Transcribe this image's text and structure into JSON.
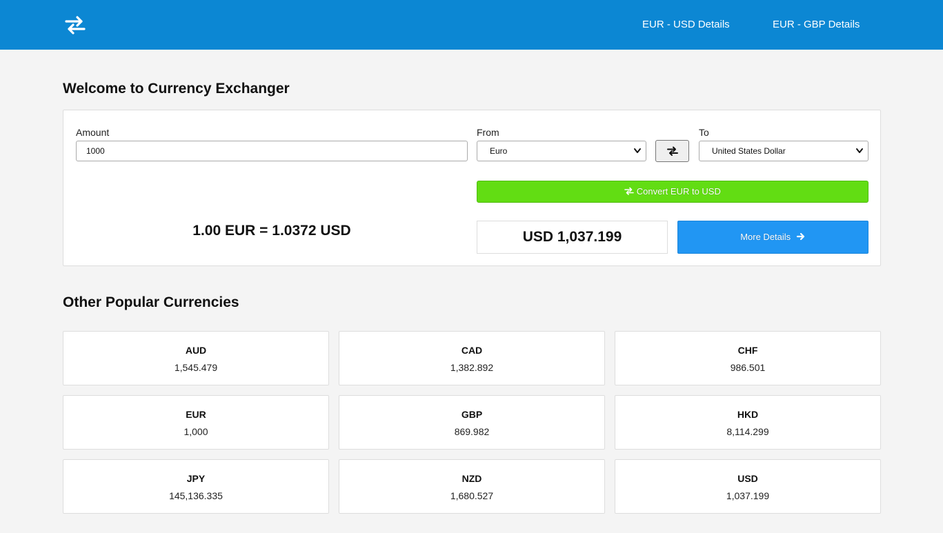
{
  "header": {
    "logo_icon": "exchange-arrows-icon",
    "nav": [
      {
        "label": "EUR - USD Details"
      },
      {
        "label": "EUR - GBP Details"
      }
    ],
    "color": "#0c87d3"
  },
  "main": {
    "title": "Welcome to Currency Exchanger"
  },
  "converter": {
    "amount_label": "Amount",
    "amount_value": "1000",
    "from_label": "From",
    "from_value": "Euro",
    "to_label": "To",
    "to_value": "United States Dollar",
    "swap_icon": "swap-arrows-icon",
    "convert_label": "Convert EUR to USD",
    "convert_color": "#62dd13",
    "rate_text": "1.00 EUR = 1.0372 USD",
    "result": "USD 1,037.199",
    "details_label": "More Details",
    "details_icon": "arrow-right-icon",
    "details_color": "#2196f3"
  },
  "popular": {
    "title": "Other Popular Currencies",
    "items": [
      {
        "code": "AUD",
        "value": "1,545.479"
      },
      {
        "code": "CAD",
        "value": "1,382.892"
      },
      {
        "code": "CHF",
        "value": "986.501"
      },
      {
        "code": "EUR",
        "value": "1,000"
      },
      {
        "code": "GBP",
        "value": "869.982"
      },
      {
        "code": "HKD",
        "value": "8,114.299"
      },
      {
        "code": "JPY",
        "value": "145,136.335"
      },
      {
        "code": "NZD",
        "value": "1,680.527"
      },
      {
        "code": "USD",
        "value": "1,037.199"
      }
    ]
  }
}
